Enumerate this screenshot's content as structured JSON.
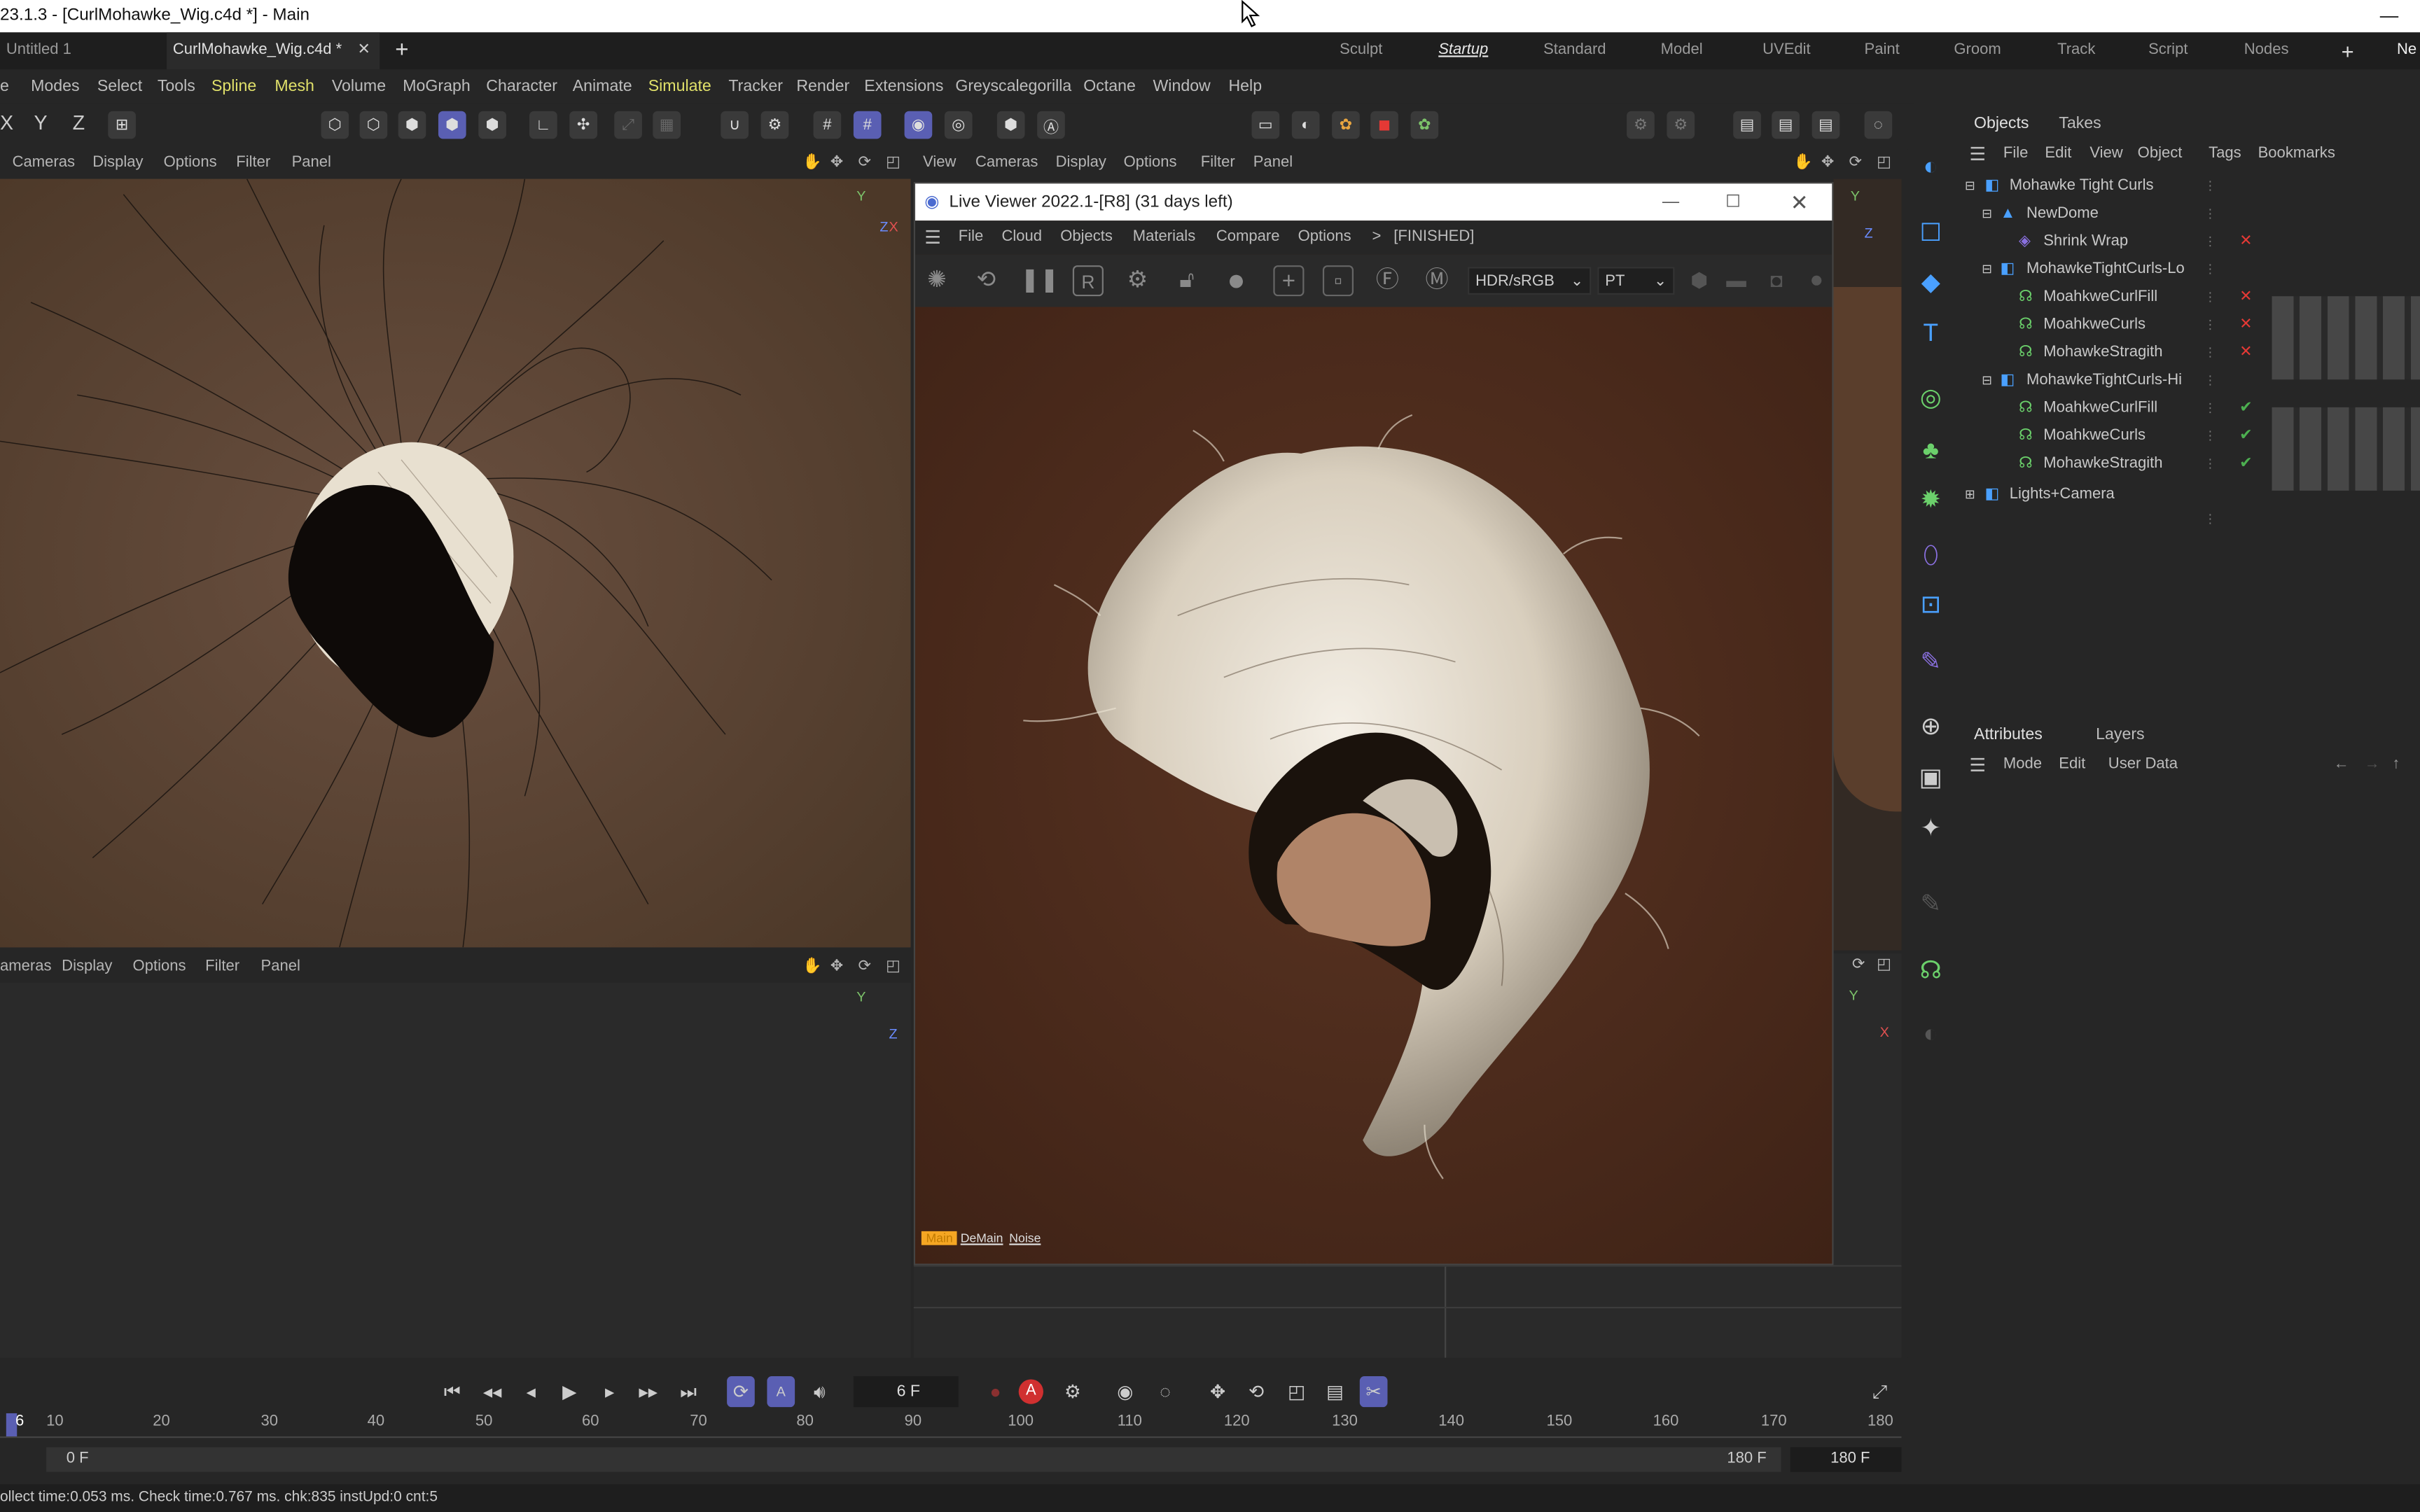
{
  "window": {
    "title": "23.1.3 - [CurlMohawke_Wig.c4d *] - Main"
  },
  "tabs": [
    {
      "label": "Untitled 1"
    },
    {
      "label": "CurlMohawke_Wig.c4d *"
    }
  ],
  "layouts": [
    "Sculpt",
    "Startup",
    "Standard",
    "Model",
    "UVEdit",
    "Paint",
    "Groom",
    "Track",
    "Script",
    "Nodes",
    "Ne"
  ],
  "menu": [
    "e",
    "Modes",
    "Select",
    "Tools",
    "Spline",
    "Mesh",
    "Volume",
    "MoGraph",
    "Character",
    "Animate",
    "Simulate",
    "Tracker",
    "Render",
    "Extensions",
    "Greyscalegorilla",
    "Octane",
    "Window",
    "Help"
  ],
  "axis_buttons": [
    "X",
    "Y",
    "Z"
  ],
  "viewport_left": {
    "menu": [
      "Cameras",
      "Display",
      "Options",
      "Filter",
      "Panel"
    ]
  },
  "viewport_right": {
    "menu": [
      "View",
      "Cameras",
      "Display",
      "Options",
      "Filter",
      "Panel"
    ]
  },
  "viewport_bottom": {
    "menu": [
      "ameras",
      "Display",
      "Options",
      "Filter",
      "Panel"
    ]
  },
  "axes": {
    "y": "Y",
    "x": "X",
    "z": "Z"
  },
  "live_viewer": {
    "title": "Live Viewer 2022.1-[R8] (31 days left)",
    "menu": [
      "File",
      "Cloud",
      "Objects",
      "Materials",
      "Compare",
      "Options"
    ],
    "status": "[FINISHED]",
    "arrow": ">",
    "color_space": "HDR/sRGB",
    "kernel": "PT",
    "passes": [
      "Main",
      "DeMain",
      "Noise"
    ]
  },
  "objects_panel": {
    "tabs": [
      "Objects",
      "Takes"
    ],
    "menu": [
      "File",
      "Edit",
      "View",
      "Object",
      "Tags",
      "Bookmarks"
    ],
    "items": [
      {
        "label": "Mohawke Tight Curls",
        "status": ""
      },
      {
        "label": "NewDome",
        "status": ""
      },
      {
        "label": "Shrink Wrap",
        "status": "x"
      },
      {
        "label": "MohawkeTightCurls-Lo",
        "status": ""
      },
      {
        "label": "MoahkweCurlFill",
        "status": "x"
      },
      {
        "label": "MoahkweCurls",
        "status": "x"
      },
      {
        "label": "MohawkeStragith",
        "status": "x"
      },
      {
        "label": "MohawkeTightCurls-Hi",
        "status": ""
      },
      {
        "label": "MoahkweCurlFill",
        "status": "check"
      },
      {
        "label": "MoahkweCurls",
        "status": "check"
      },
      {
        "label": "MohawkeStragith",
        "status": "check"
      },
      {
        "label": "Lights+Camera",
        "status": ""
      }
    ]
  },
  "attributes_panel": {
    "tabs": [
      "Attributes",
      "Layers"
    ],
    "menu": [
      "Mode",
      "Edit",
      "User Data"
    ]
  },
  "timeline": {
    "current_frame": "6 F",
    "ticks": [
      "6",
      "10",
      "20",
      "30",
      "40",
      "50",
      "60",
      "70",
      "80",
      "90",
      "100",
      "110",
      "120",
      "130",
      "140",
      "150",
      "160",
      "170",
      "180"
    ],
    "start": "0 F",
    "end": "180 F",
    "end_field": "180 F",
    "current_fraction": 0.033
  },
  "status_bar": "ollect time:0.053 ms.  Check time:0.767 ms.  chk:835  instUpd:0  cnt:5",
  "colors": {
    "accent": "#5a5fb3",
    "check": "#4caf50",
    "cross": "#e53935",
    "pass_active": "#f5a623"
  }
}
